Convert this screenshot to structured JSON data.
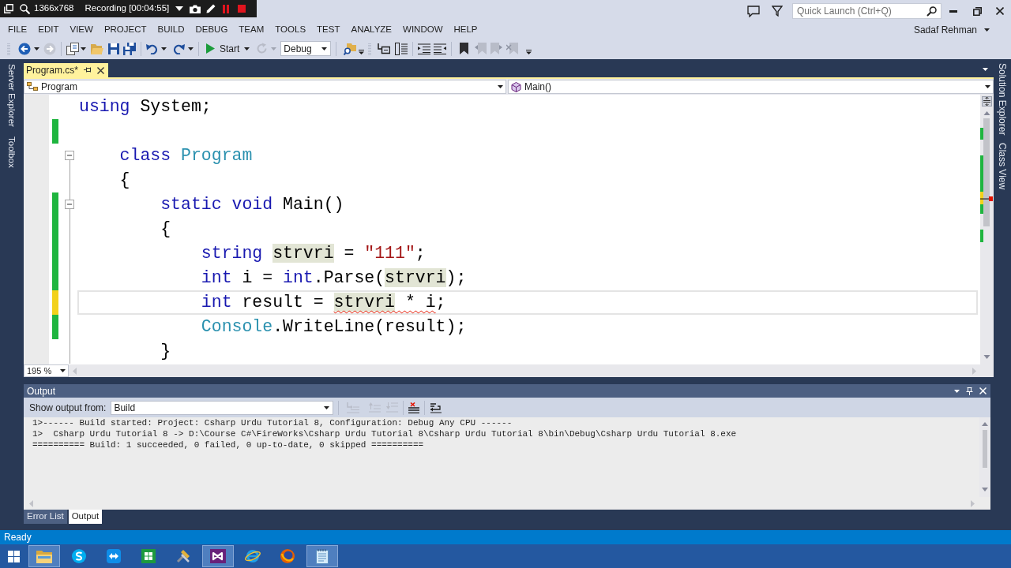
{
  "recorder": {
    "resolution": "1366x768",
    "status": "Recording [00:04:55]"
  },
  "quick_launch": {
    "placeholder": "Quick Launch (Ctrl+Q)"
  },
  "menu": [
    "FILE",
    "EDIT",
    "VIEW",
    "PROJECT",
    "BUILD",
    "DEBUG",
    "TEAM",
    "TOOLS",
    "TEST",
    "ANALYZE",
    "WINDOW",
    "HELP"
  ],
  "account": "Sadaf Rehman",
  "toolbar": {
    "start_label": "Start",
    "configuration": "Debug"
  },
  "left_dock_tabs": [
    "Server Explorer",
    "Toolbox"
  ],
  "right_dock_tabs": [
    "Solution Explorer",
    "Class View"
  ],
  "document_tabs": [
    {
      "label": "Program.cs*",
      "selected": true
    }
  ],
  "navigation_bar": {
    "type": "Program",
    "member": "Main()"
  },
  "editor": {
    "zoom": "195 %",
    "lines": [
      {
        "current": false,
        "modified": false,
        "tokens": [
          {
            "text": "using",
            "kind": "keyword"
          },
          {
            "text": " System;",
            "kind": "text"
          }
        ]
      },
      {
        "current": false,
        "modified": true,
        "saved": true
      },
      {
        "current": false,
        "modified": false,
        "expanded": true,
        "tokens": [
          {
            "text": "    class",
            "kind": "keyword"
          },
          {
            "text": " Program",
            "kind": "type"
          }
        ]
      },
      {
        "current": false,
        "modified": false,
        "tokens": [
          {
            "text": "    {",
            "kind": "text"
          }
        ]
      },
      {
        "current": false,
        "modified": true,
        "saved": true,
        "expanded": true,
        "tokens": [
          {
            "text": "        static void",
            "kind": "keyword"
          },
          {
            "text": " Main()",
            "kind": "text"
          }
        ]
      },
      {
        "current": false,
        "modified": true,
        "saved": true,
        "tokens": [
          {
            "text": "        {",
            "kind": "text"
          }
        ]
      },
      {
        "current": false,
        "modified": true,
        "saved": true,
        "tokens": [
          {
            "text": "            string ",
            "kind": "keyword"
          },
          {
            "text": "strvri",
            "kind": "reference"
          },
          {
            "text": " = ",
            "kind": "text"
          },
          {
            "text": "\"111\"",
            "kind": "string"
          },
          {
            "text": ";",
            "kind": "text"
          }
        ]
      },
      {
        "current": false,
        "modified": true,
        "saved": true,
        "tokens": [
          {
            "text": "            int",
            "kind": "keyword"
          },
          {
            "text": " i = ",
            "kind": "text"
          },
          {
            "text": "int",
            "kind": "keyword"
          },
          {
            "text": ".Parse(",
            "kind": "text"
          },
          {
            "text": "strvri",
            "kind": "reference"
          },
          {
            "text": ");",
            "kind": "text"
          }
        ]
      },
      {
        "current": true,
        "modified": true,
        "saved": false,
        "tokens": [
          {
            "text": "            int",
            "kind": "keyword"
          },
          {
            "text": " result = ",
            "kind": "text"
          },
          {
            "text": "strvri",
            "kind": "reference_error"
          },
          {
            "text": " * i",
            "kind": "error"
          },
          {
            "text": ";",
            "kind": "text"
          }
        ]
      },
      {
        "current": false,
        "modified": true,
        "saved": true,
        "tokens": [
          {
            "text": "            Console",
            "kind": "type"
          },
          {
            "text": ".WriteLine(result);",
            "kind": "text"
          }
        ]
      },
      {
        "current": false,
        "modified": false,
        "tokens": [
          {
            "text": "        }",
            "kind": "text"
          }
        ]
      }
    ]
  },
  "output": {
    "title": "Output",
    "source_label": "Show output from:",
    "source": "Build",
    "lines": [
      "1>------ Build started: Project: Csharp Urdu Tutorial 8, Configuration: Debug Any CPU ------",
      "1>  Csharp Urdu Tutorial 8 -> D:\\Course C#\\FireWorks\\Csharp Urdu Tutorial 8\\Csharp Urdu Tutorial 8\\bin\\Debug\\Csharp Urdu Tutorial 8.exe",
      "========== Build: 1 succeeded, 0 failed, 0 up-to-date, 0 skipped =========="
    ]
  },
  "bottom_tabs": [
    {
      "label": "Error List",
      "selected": false
    },
    {
      "label": "Output",
      "selected": true
    }
  ],
  "status_bar": {
    "text": "Ready"
  },
  "taskbar": [
    {
      "open": true
    },
    {
      "open": false
    },
    {
      "open": false
    },
    {
      "open": false
    },
    {
      "open": false
    },
    {
      "open": true
    },
    {
      "open": false
    },
    {
      "open": false
    },
    {
      "open": true
    }
  ]
}
